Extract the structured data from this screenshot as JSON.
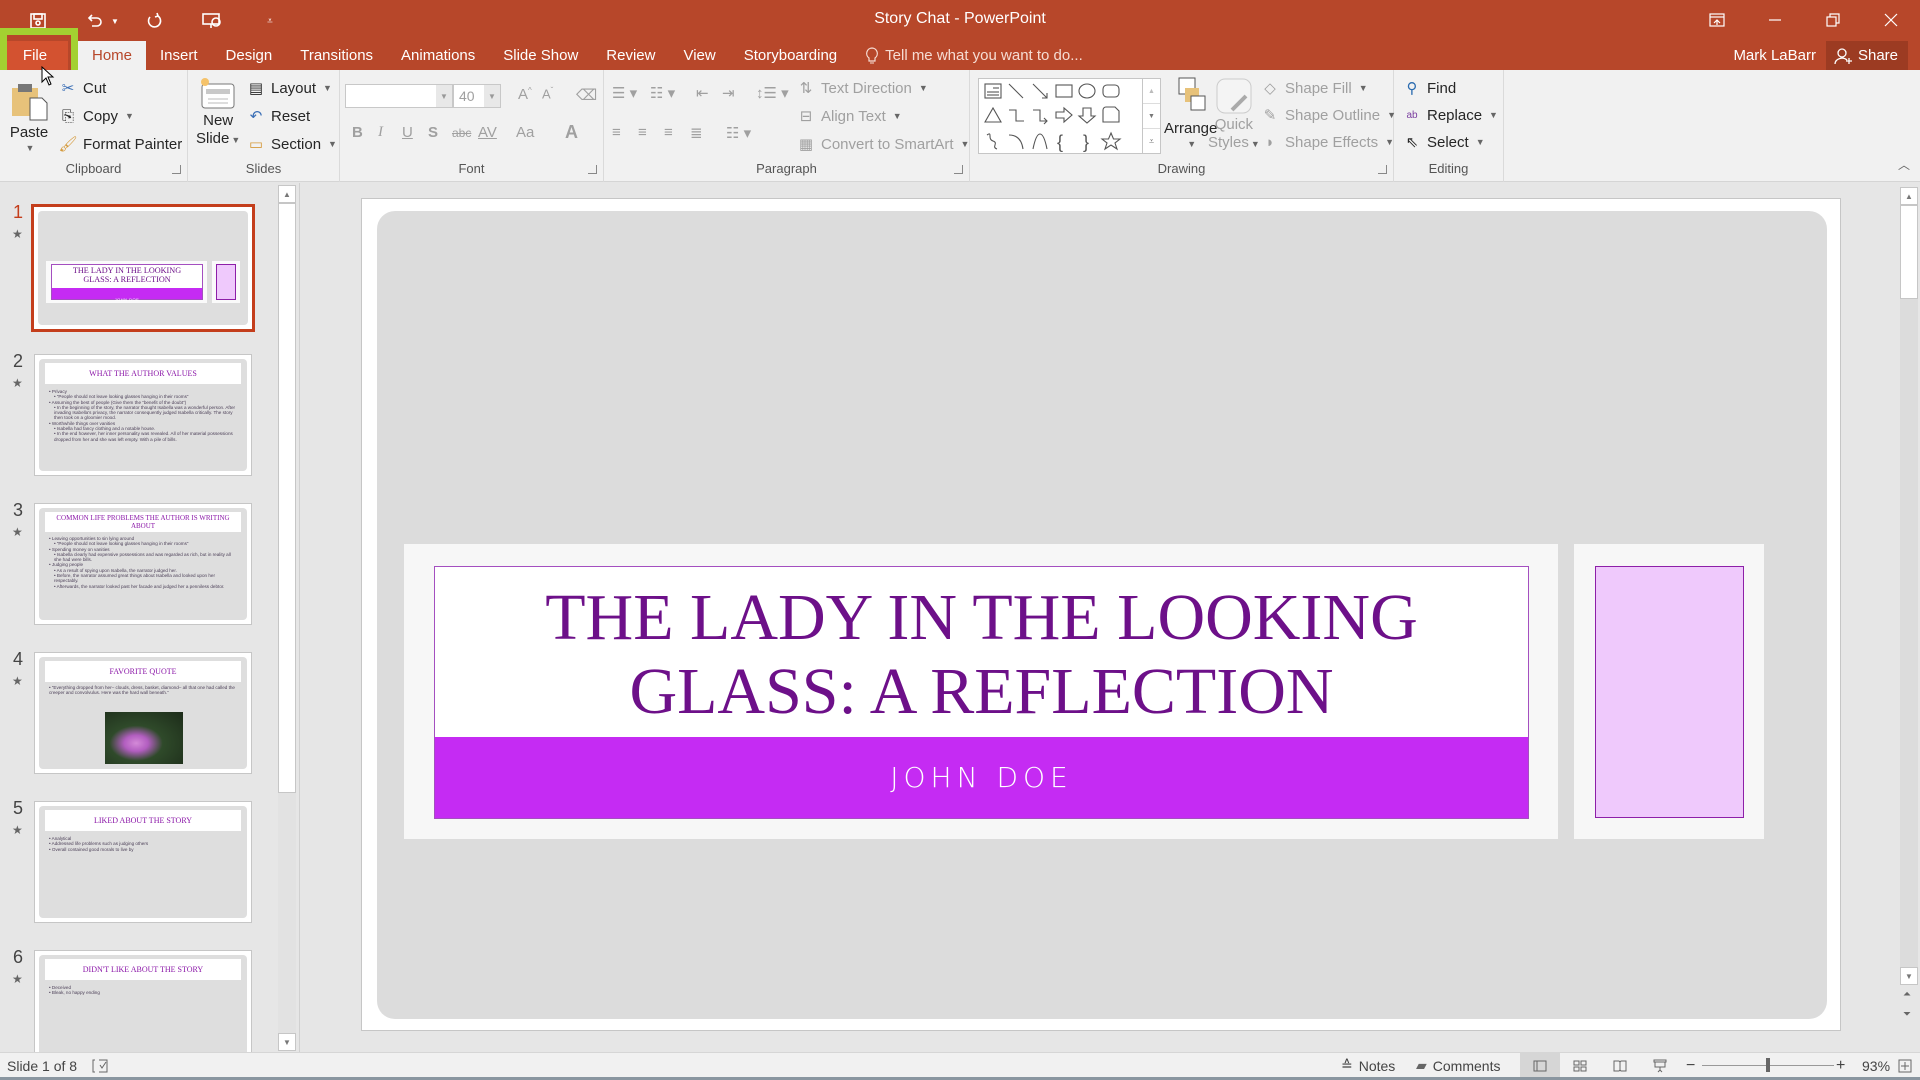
{
  "window": {
    "title": "Story Chat - PowerPoint",
    "controls": [
      "ribbon-display-options",
      "minimize",
      "restore",
      "close"
    ]
  },
  "quick_access": {
    "items": [
      "save",
      "undo",
      "undo-dropdown",
      "redo",
      "start-from-beginning",
      "customize"
    ]
  },
  "tabs": {
    "file": "File",
    "items": [
      "Home",
      "Insert",
      "Design",
      "Transitions",
      "Animations",
      "Slide Show",
      "Review",
      "View",
      "Storyboarding"
    ],
    "active": "Home",
    "tell_me": "Tell me what you want to do..."
  },
  "account": {
    "user": "Mark LaBarr",
    "share": "Share"
  },
  "ribbon": {
    "clipboard": {
      "label": "Clipboard",
      "paste": "Paste",
      "cut": "Cut",
      "copy": "Copy",
      "format_painter": "Format Painter"
    },
    "slides": {
      "label": "Slides",
      "new_slide_line1": "New",
      "new_slide_line2": "Slide",
      "layout": "Layout",
      "reset": "Reset",
      "section": "Section"
    },
    "font": {
      "label": "Font",
      "font_name": "",
      "font_size": "40",
      "bold": "B",
      "italic": "I",
      "underline": "U",
      "shadow": "S",
      "strike": "abc",
      "spacing": "AV",
      "case": "Aa",
      "color": "A"
    },
    "paragraph": {
      "label": "Paragraph",
      "text_direction": "Text Direction",
      "align_text": "Align Text",
      "convert_smartart": "Convert to SmartArt"
    },
    "drawing": {
      "label": "Drawing",
      "arrange": "Arrange",
      "quick_styles_line1": "Quick",
      "quick_styles_line2": "Styles",
      "shape_fill": "Shape Fill",
      "shape_outline": "Shape Outline",
      "shape_effects": "Shape Effects",
      "shapes": [
        "text-box",
        "line",
        "arrow",
        "rectangle",
        "oval",
        "rounded-rectangle",
        "triangle",
        "elbow-connector",
        "elbow-arrow",
        "right-arrow",
        "down-arrow",
        "snip-shape",
        "freeform",
        "arc",
        "curve",
        "left-brace",
        "right-brace",
        "star"
      ]
    },
    "editing": {
      "label": "Editing",
      "find": "Find",
      "replace": "Replace",
      "select": "Select"
    }
  },
  "thumbnails": [
    {
      "number": "1",
      "title": "THE LADY IN THE LOOKING GLASS: A REFLECTION",
      "subtitle": "JOHN DOE",
      "active": true
    },
    {
      "number": "2",
      "title": "WHAT THE AUTHOR VALUES",
      "bullets": [
        {
          "text": "Privacy",
          "level": 1
        },
        {
          "text": "“People should not leave looking glasses hanging in their rooms”",
          "level": 2
        },
        {
          "text": "Assuming the best of people (Give them the “benefit of the doubt”)",
          "level": 1
        },
        {
          "text": "In the beginning of the story, the narrator thought Isabella was a wonderful person. After invading Isabella's privacy, the narrator consequently judged Isabella critically. The story then took on a gloomier mood.",
          "level": 2
        },
        {
          "text": "Worthwhile things over vanities",
          "level": 1
        },
        {
          "text": "Isabella had fancy clothing and a notable house.",
          "level": 2
        },
        {
          "text": "In the end however, her inner personality was revealed. All of her material possessions dropped from her and she was left empty. With a pile of bills.",
          "level": 2
        }
      ]
    },
    {
      "number": "3",
      "title": "COMMON LIFE PROBLEMS THE AUTHOR IS WRITING ABOUT",
      "bullets": [
        {
          "text": "Leaving opportunities to sin lying around",
          "level": 1
        },
        {
          "text": "“People should not leave looking glasses hanging in their rooms”",
          "level": 2
        },
        {
          "text": "Spending money on vanities",
          "level": 1
        },
        {
          "text": "Isabella clearly had expensive possessions and was regarded as rich, but in reality all she had were bills.",
          "level": 2
        },
        {
          "text": "Judging people",
          "level": 1
        },
        {
          "text": "As a result of spying upon Isabella, the narrator judged her.",
          "level": 2
        },
        {
          "text": "Before, the narrator assumed great things about Isabella and looked upon her respectably.",
          "level": 2
        },
        {
          "text": "Afterwards, the narrator looked past her facade and judged her a penniless debtor.",
          "level": 2
        }
      ]
    },
    {
      "number": "4",
      "title": "FAVORITE QUOTE",
      "bullets": [
        {
          "text": "“Everything dropped from her– clouds, dress, basket, diamond– all that one had called the creeper and convolvulus. Here was the hard wall beneath.”",
          "level": 1
        }
      ],
      "image": "pink-flower-photo"
    },
    {
      "number": "5",
      "title": "LIKED ABOUT THE STORY",
      "bullets": [
        {
          "text": "Analytical",
          "level": 1
        },
        {
          "text": "Addressed life problems such as judging others",
          "level": 1
        },
        {
          "text": "Overall contained good morals to live by",
          "level": 1
        }
      ]
    },
    {
      "number": "6",
      "title": "DIDN'T LIKE ABOUT THE STORY",
      "bullets": [
        {
          "text": "Deceived",
          "level": 1
        },
        {
          "text": "Bleak, no happy ending",
          "level": 1
        }
      ]
    }
  ],
  "slide": {
    "title": "THE LADY IN THE LOOKING GLASS: A REFLECTION",
    "subtitle": "JOHN DOE"
  },
  "status": {
    "slide_info": "Slide 1 of 8",
    "notes": "Notes",
    "comments": "Comments",
    "zoom": "93%",
    "zoom_fraction": 0.5
  },
  "colors": {
    "titlebar": "#b7472a",
    "title_text": "#6d1089",
    "subtitle_band": "#c52bf3",
    "side_box": "#efc9fc",
    "highlight": "#a3d131"
  }
}
